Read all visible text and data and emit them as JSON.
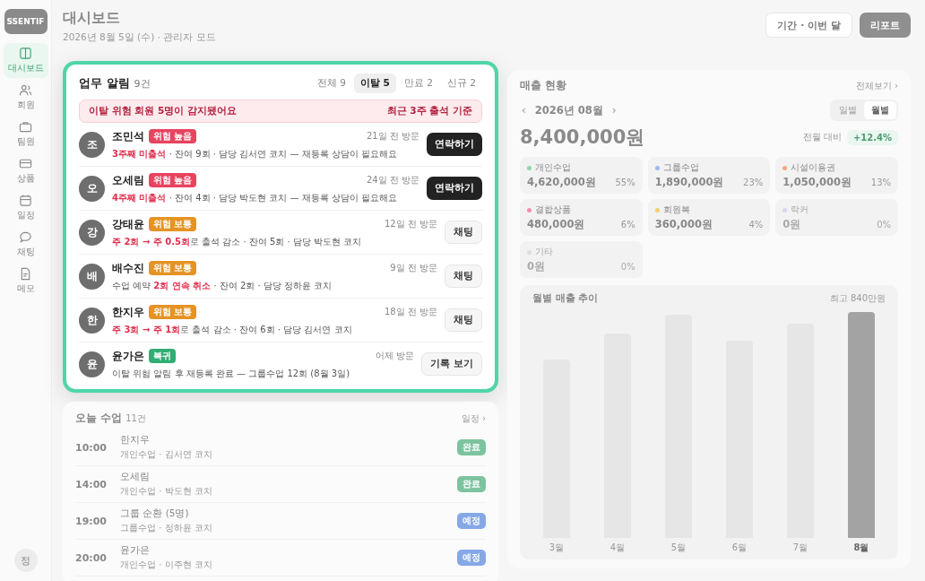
{
  "sidebar": {
    "logo": "SSENTIF",
    "items": [
      {
        "label": "대시보드",
        "selected": true
      },
      {
        "label": "회원",
        "selected": false
      },
      {
        "label": "팀원",
        "selected": false
      },
      {
        "label": "상품",
        "selected": false
      },
      {
        "label": "일정",
        "selected": false
      },
      {
        "label": "채팅",
        "selected": false
      },
      {
        "label": "메모",
        "selected": false
      }
    ],
    "user": "정"
  },
  "header": {
    "title": "대시보드",
    "subtitle": "2026년 8월 5일 (수) · 관리자 모드",
    "buttons": [
      {
        "label": "기간 · 이번 달",
        "kind": "secondary"
      },
      {
        "label": "리포트",
        "kind": "primary"
      }
    ]
  },
  "alerts": {
    "title": "업무 알림",
    "count": "9건",
    "tabs": [
      {
        "label": "전체 9",
        "selected": false
      },
      {
        "label": "이탈 5",
        "selected": true
      },
      {
        "label": "만료 2",
        "selected": false
      },
      {
        "label": "신규 2",
        "selected": false
      }
    ],
    "banner": {
      "message": "이탈 위험 회원 5명이 감지됐어요",
      "note": "최근 3주 출석 기준"
    },
    "rows": [
      {
        "avatar": "조",
        "name": "조민석",
        "badge": {
          "text": "위험 높음",
          "kind": "high"
        },
        "detail": "**3주째 미출석** · 잔여 9회 · 담당 김서연 코치 — 재등록 상담이 필요해요",
        "visit": "21일 전 방문",
        "action": {
          "label": "연락하기",
          "kind": "primary"
        }
      },
      {
        "avatar": "오",
        "name": "오세림",
        "badge": {
          "text": "위험 높음",
          "kind": "high"
        },
        "detail": "**4주째 미출석** · 잔여 4회 · 담당 박도현 코치 — 재등록 상담이 필요해요",
        "visit": "24일 전 방문",
        "action": {
          "label": "연락하기",
          "kind": "primary"
        }
      },
      {
        "avatar": "강",
        "name": "강태윤",
        "badge": {
          "text": "위험 보통",
          "kind": "mid"
        },
        "detail": "**주 2회 → 주 0.5회**로 출석 감소 · 잔여 5회 · 담당 박도현 코치",
        "visit": "12일 전 방문",
        "action": {
          "label": "채팅",
          "kind": "secondary"
        }
      },
      {
        "avatar": "배",
        "name": "배수진",
        "badge": {
          "text": "위험 보통",
          "kind": "mid"
        },
        "detail": "수업 예약 **2회 연속 취소** · 잔여 2회 · 담당 정하윤 코치",
        "visit": "9일 전 방문",
        "action": {
          "label": "채팅",
          "kind": "secondary"
        }
      },
      {
        "avatar": "한",
        "name": "한지우",
        "badge": {
          "text": "위험 보통",
          "kind": "mid"
        },
        "detail": "**주 3회 → 주 1회**로 출석 감소 · 잔여 6회 · 담당 김서연 코치",
        "visit": "18일 전 방문",
        "action": {
          "label": "채팅",
          "kind": "secondary"
        }
      },
      {
        "avatar": "윤",
        "name": "윤가은",
        "badge": {
          "text": "복귀",
          "kind": "back"
        },
        "detail": "이탈 위험 알림 후 재등록 완료 — 그룹수업 12회 (8월 3일)",
        "visit": "어제 방문",
        "action": {
          "label": "기록 보기",
          "kind": "secondary"
        }
      }
    ]
  },
  "today": {
    "title": "오늘 수업",
    "count": "11건",
    "link": "일정 ›",
    "rows": [
      {
        "time": "10:00",
        "name": "한지우",
        "sub": "개인수업 · 김서연 코치",
        "status": {
          "text": "완료",
          "kind": "done"
        }
      },
      {
        "time": "14:00",
        "name": "오세림",
        "sub": "개인수업 · 박도현 코치",
        "status": {
          "text": "완료",
          "kind": "done"
        }
      },
      {
        "time": "19:00",
        "name": "그룹 순환 (5명)",
        "sub": "그룹수업 · 정하윤 코치",
        "status": {
          "text": "예정",
          "kind": "planned"
        }
      },
      {
        "time": "20:00",
        "name": "윤가은",
        "sub": "개인수업 · 이주현 코치",
        "status": {
          "text": "예정",
          "kind": "planned"
        }
      }
    ]
  },
  "sales": {
    "title": "매출 현황",
    "link": "전체보기 ›",
    "prev": "‹",
    "month": "2026년 08월",
    "next": "›",
    "modes": [
      {
        "label": "일별",
        "selected": false
      },
      {
        "label": "월별",
        "selected": true
      }
    ],
    "total": "8,400,000원",
    "compare_label": "전월 대비",
    "compare_value": "+12.4%",
    "categories": [
      {
        "name": "개인수업",
        "amount": "4,620,000원",
        "share": "55%",
        "color": "#8fd3b2",
        "empty": false
      },
      {
        "name": "그룹수업",
        "amount": "1,890,000원",
        "share": "23%",
        "color": "#9cb9f2",
        "empty": false
      },
      {
        "name": "시설이용권",
        "amount": "1,050,000원",
        "share": "13%",
        "color": "#f2a97c",
        "empty": false
      },
      {
        "name": "결합상품",
        "amount": "480,000원",
        "share": "6%",
        "color": "#ef8fae",
        "empty": false
      },
      {
        "name": "회원복",
        "amount": "360,000원",
        "share": "4%",
        "color": "#f1cf6f",
        "empty": false
      },
      {
        "name": "락커",
        "amount": "0원",
        "share": "0%",
        "color": "#d9d3f2",
        "empty": true
      },
      {
        "name": "기타",
        "amount": "0원",
        "share": "0%",
        "color": "#dddddd",
        "empty": true
      }
    ],
    "trend": {
      "title": "월별 매출 추이",
      "peak": "최고 840만원",
      "months": [
        {
          "label": "3월",
          "selected": false
        },
        {
          "label": "4월",
          "selected": false
        },
        {
          "label": "5월",
          "selected": false
        },
        {
          "label": "6월",
          "selected": false
        },
        {
          "label": "7월",
          "selected": false
        },
        {
          "label": "8월",
          "selected": true
        }
      ]
    }
  }
}
